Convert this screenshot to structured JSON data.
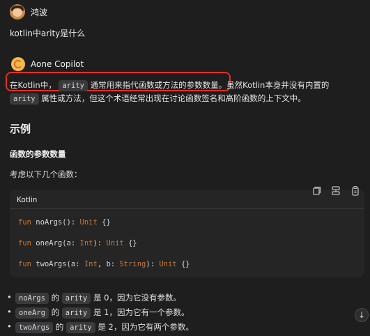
{
  "user": {
    "name": "鸿波",
    "question": "kotlin中arity是什么"
  },
  "bot": {
    "name": "Aone Copilot"
  },
  "answer": {
    "line1_prefix": "在Kotlin中，",
    "line1_code": "arity",
    "line1_mid": "通常用来指代函数或方法的参数数量。",
    "line1_suffix": "虽然Kotlin本身并没有内置的",
    "line2_code": "arity",
    "line2_text": "属性或方法，但这个术语经常出现在讨论函数签名和高阶函数的上下文中。",
    "section_title": "示例",
    "sub_title": "函数的参数数量",
    "intro": "考虑以下几个函数："
  },
  "code_block": {
    "language": "Kotlin",
    "lines": [
      {
        "kw": "fun",
        "name": "noArgs(): ",
        "type": "Unit",
        "rest": " {}"
      },
      {
        "kw": "fun",
        "name": "oneArg(a: ",
        "type": "Int",
        "rest": "): ",
        "type2": "Unit",
        "rest2": " {}"
      },
      {
        "kw": "fun",
        "name": "twoArgs(a: ",
        "type": "Int",
        "rest": ", b: ",
        "type2": "String",
        "rest2": "): ",
        "type3": "Unit",
        "rest3": " {}"
      }
    ],
    "toolbar_icons": [
      "copy-icon",
      "insert-icon",
      "clipboard-icon"
    ]
  },
  "bullets": [
    {
      "fn": "noArgs",
      "of": "的",
      "code": "arity",
      "text": "是 0，因为它没有参数。"
    },
    {
      "fn": "oneArg",
      "of": "的",
      "code": "arity",
      "text": "是 1，因为它有一个参数。"
    },
    {
      "fn": "twoArgs",
      "of": "的",
      "code": "arity",
      "text": "是 2，因为它有两个参数。"
    }
  ],
  "scroll_button": {
    "glyph": "↓"
  }
}
